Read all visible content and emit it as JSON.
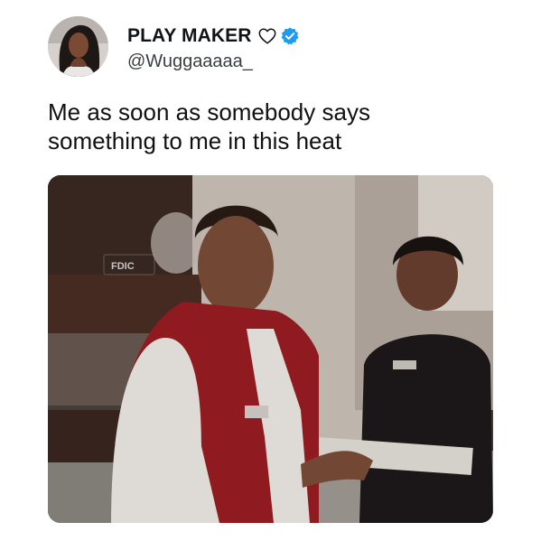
{
  "tweet": {
    "display_name": "PLAY MAKER",
    "handle": "@Wuggaaaaa_",
    "text": "Me as soon as somebody says\nsomething to me in this heat",
    "name_icons": [
      "heart-outline-icon",
      "verified-badge-icon"
    ],
    "verified_color": "#1d9bf0"
  },
  "media": {
    "sign_text": "FDIC"
  }
}
